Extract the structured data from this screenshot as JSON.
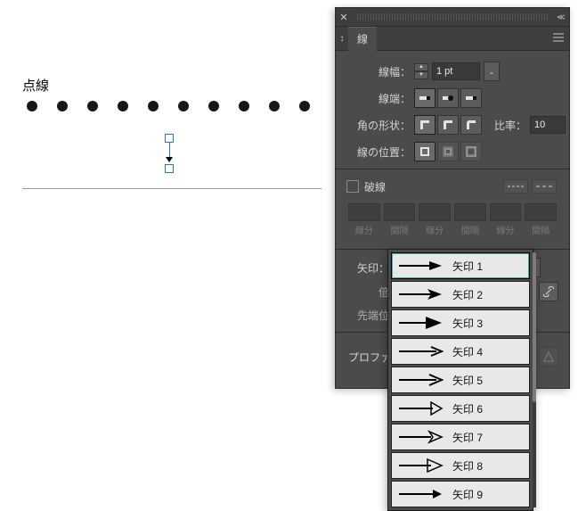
{
  "canvas": {
    "label": "点線"
  },
  "panel": {
    "tab": "線",
    "rows": {
      "weight_label": "線幅：",
      "weight_value": "1 pt",
      "cap_label": "線端：",
      "join_label": "角の形状：",
      "limit_label": "比率：",
      "limit_value": "10",
      "align_label": "線の位置："
    },
    "dashed": {
      "label": "破線",
      "columns": [
        "線分",
        "間隔",
        "線分",
        "間隔",
        "線分",
        "間隔"
      ]
    },
    "arrow": {
      "label": "矢印：",
      "scale_label": "倍",
      "align_label": "先端位"
    },
    "profile": {
      "label": "プロファイ"
    }
  },
  "dropdown": {
    "items": [
      {
        "label": "矢印 1"
      },
      {
        "label": "矢印 2"
      },
      {
        "label": "矢印 3"
      },
      {
        "label": "矢印 4"
      },
      {
        "label": "矢印 5"
      },
      {
        "label": "矢印 6"
      },
      {
        "label": "矢印 7"
      },
      {
        "label": "矢印 8"
      },
      {
        "label": "矢印 9"
      }
    ]
  }
}
